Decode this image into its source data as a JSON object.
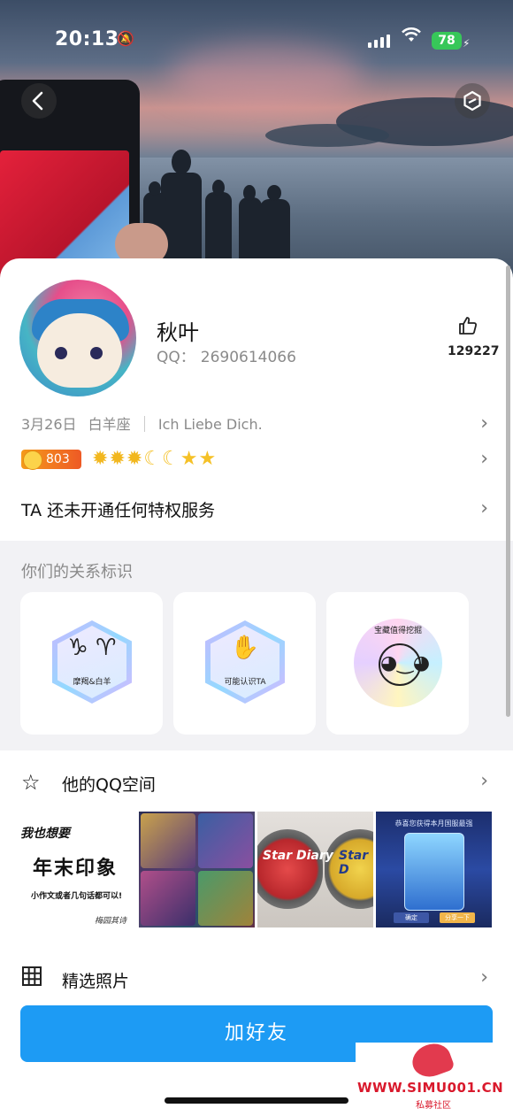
{
  "status_bar": {
    "time": "20:13",
    "battery": "78"
  },
  "profile": {
    "name": "秋叶",
    "qq_label": "QQ：",
    "qq_number": "2690614066",
    "like_count": "129227",
    "birthday": "3月26日",
    "zodiac": "白羊座",
    "signature": "Ich Liebe Dich.",
    "level": "803",
    "level_icons": {
      "suns": 3,
      "moons": 2,
      "stars": 2
    },
    "service_text": "TA 还未开通任何特权服务"
  },
  "relations": {
    "title": "你们的关系标识",
    "badges": [
      {
        "caption": "摩羯&白羊",
        "symbol": "♑ ♈"
      },
      {
        "caption": "可能认识TA",
        "symbol": "✋"
      },
      {
        "caption": "宝藏值得挖掘",
        "symbol": "◕‿◕"
      }
    ]
  },
  "qzone": {
    "label": "他的QQ空间",
    "thumbs": {
      "t1_line1": "我也想要",
      "t1_line2": "年末印象",
      "t1_line3": "小作文或者几句话都可以!",
      "t1_line4": "梅园其诗",
      "t3_label1": "Star Diary",
      "t3_label2": "Star D",
      "t4_title": "恭喜您获得本月国服最强",
      "t4_btn1": "确定",
      "t4_btn2": "分享一下"
    }
  },
  "photos": {
    "label": "精选照片"
  },
  "add_friend": "加好友",
  "watermark": {
    "url": "WWW.SIMU001.CN",
    "name": "私募社区"
  },
  "colors": {
    "primary": "#1d9bf4",
    "level_badge": "#f07a20",
    "battery": "#37c759"
  }
}
